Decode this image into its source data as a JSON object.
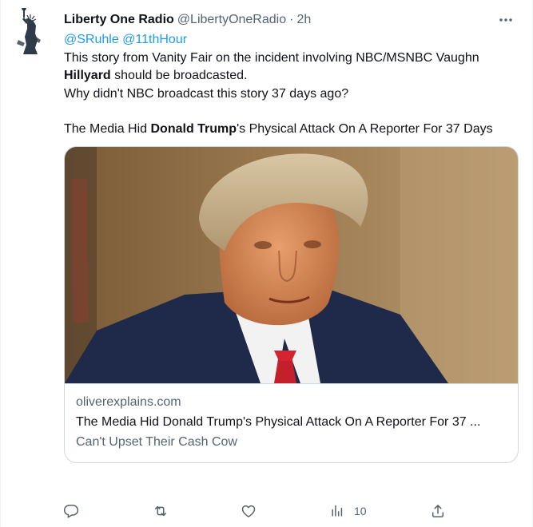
{
  "tweet": {
    "author_name": "Liberty One Radio",
    "author_handle": "@LibertyOneRadio",
    "separator": "·",
    "time": "2h",
    "mentions": [
      "@SRuhle",
      "@11thHour"
    ],
    "body": {
      "line1": "This story from Vanity Fair on the incident involving NBC/MSNBC Vaughn",
      "line2_bold": "Hillyard",
      "line2_rest": " should be broadcasted.",
      "line3": "Why didn't NBC broadcast this story 37 days ago?",
      "line4_pre": "The Media Hid ",
      "line4_bold": "Donald Trump",
      "line4_post": "'s Physical Attack On A Reporter For 37 Days"
    },
    "card": {
      "domain": "oliverexplains.com",
      "title": "The Media Hid Donald Trump's Physical Attack On A Reporter For 37 ...",
      "description": "Can't Upset Their Cash Cow"
    },
    "actions": {
      "views_count": "10"
    }
  },
  "icons": {
    "avatar": "statue-of-liberty-logo",
    "more": "more-horizontal-icon",
    "reply": "reply-icon",
    "retweet": "retweet-icon",
    "like": "like-icon",
    "views": "views-icon",
    "share": "share-icon"
  },
  "colors": {
    "accent": "#1d9bf0",
    "text": "#0f1419",
    "muted": "#536471",
    "border": "#cfd9de"
  }
}
